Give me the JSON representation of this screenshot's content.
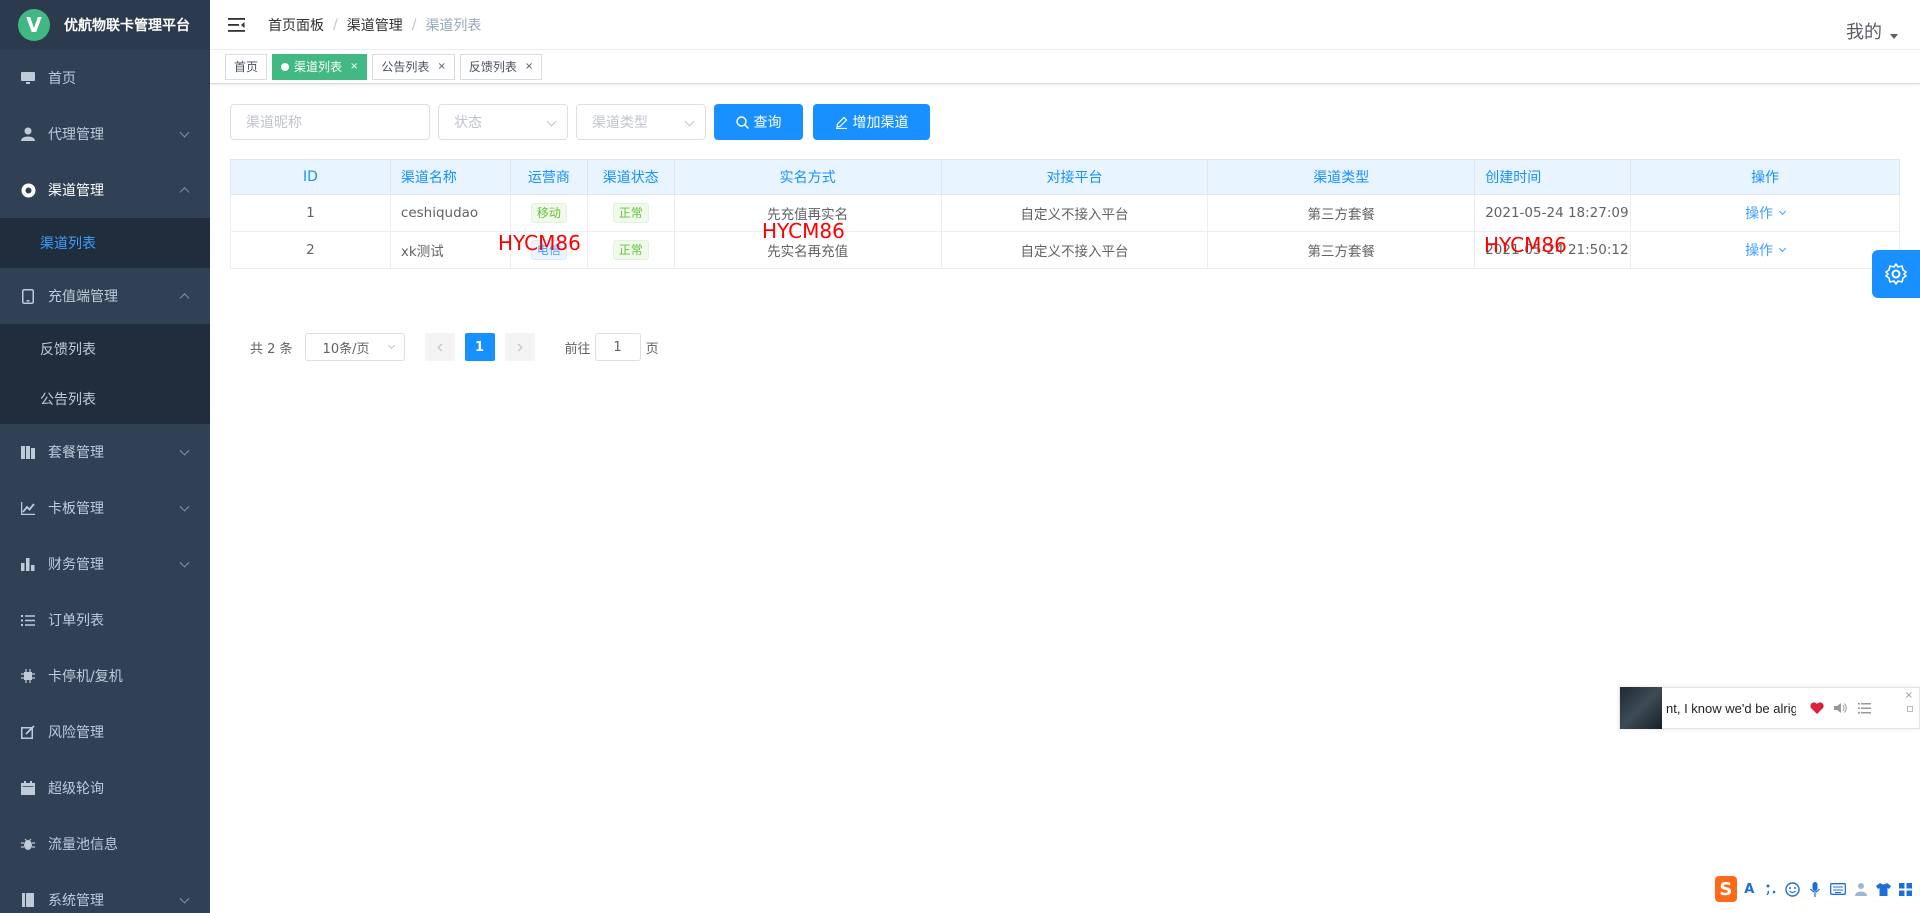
{
  "app": {
    "title": "优航物联卡管理平台",
    "logo_letter": "V"
  },
  "sidebar": {
    "items": [
      {
        "label": "首页",
        "icon": "monitor-icon"
      },
      {
        "label": "代理管理",
        "icon": "user-icon"
      },
      {
        "label": "渠道管理",
        "icon": "channel-icon"
      },
      {
        "label": "渠道列表",
        "icon": ""
      },
      {
        "label": "充值端管理",
        "icon": "phone-icon"
      },
      {
        "label": "反馈列表",
        "icon": ""
      },
      {
        "label": "公告列表",
        "icon": ""
      },
      {
        "label": "套餐管理",
        "icon": "package-icon"
      },
      {
        "label": "卡板管理",
        "icon": "chart-line-icon"
      },
      {
        "label": "财务管理",
        "icon": "bar-chart-icon"
      },
      {
        "label": "订单列表",
        "icon": "list-icon"
      },
      {
        "label": "卡停机/复机",
        "icon": "chip-icon"
      },
      {
        "label": "风险管理",
        "icon": "edit-icon"
      },
      {
        "label": "超级轮询",
        "icon": "calendar-icon"
      },
      {
        "label": "流量池信息",
        "icon": "bug-icon"
      },
      {
        "label": "系统管理",
        "icon": "book-icon"
      }
    ]
  },
  "header": {
    "breadcrumb": [
      "首页面板",
      "渠道管理",
      "渠道列表"
    ],
    "user_label": "我的"
  },
  "tags": [
    {
      "label": "首页"
    },
    {
      "label": "渠道列表"
    },
    {
      "label": "公告列表"
    },
    {
      "label": "反馈列表"
    }
  ],
  "filter": {
    "name_placeholder": "渠道昵称",
    "status_placeholder": "状态",
    "type_placeholder": "渠道类型",
    "search_label": "查询",
    "add_label": "增加渠道"
  },
  "table": {
    "headers": [
      "ID",
      "渠道名称",
      "运营商",
      "渠道状态",
      "实名方式",
      "对接平台",
      "渠道类型",
      "创建时间",
      "操作"
    ],
    "rows": [
      {
        "id": "1",
        "name": "ceshiqudao",
        "operator": "移动",
        "status": "正常",
        "realname": "先充值再实名",
        "platform": "自定义不接入平台",
        "type": "第三方套餐",
        "created": "2021-05-24 18:27:09",
        "op": "操作"
      },
      {
        "id": "2",
        "name": "xk测试",
        "operator": "电信",
        "status": "正常",
        "realname": "先实名再充值",
        "platform": "自定义不接入平台",
        "type": "第三方套餐",
        "created": "2021-05-24 21:50:12",
        "op": "操作"
      }
    ]
  },
  "watermark": "HYCM86",
  "pagination": {
    "total_label": "共 2 条",
    "page_size": "10条/页",
    "current_page": "1",
    "goto_prefix": "前往",
    "goto_value": "1",
    "goto_suffix": "页"
  },
  "music": {
    "lyric": "nt, I know we'd be alright"
  },
  "ime": {
    "logo": "S",
    "a_label": "A"
  }
}
